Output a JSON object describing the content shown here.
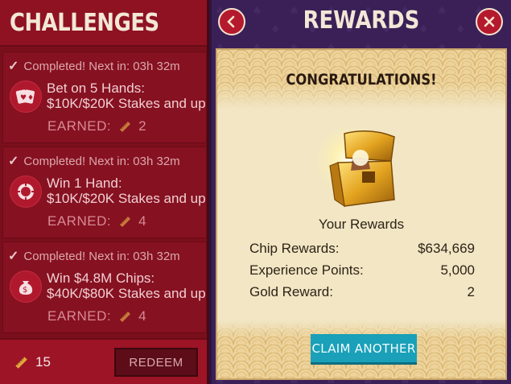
{
  "left_panel": {
    "title": "CHALLENGES",
    "challenges": [
      {
        "status": "Completed!  Next in: 03h 32m",
        "title_line1": "Bet on 5 Hands:",
        "title_line2": "$10K/$20K Stakes and up",
        "earned_label": "EARNED:",
        "earned_value": "2",
        "icon": "playing-cards-icon"
      },
      {
        "status": "Completed!  Next in: 03h 32m",
        "title_line1": "Win 1 Hand:",
        "title_line2": "$10K/$20K Stakes and up",
        "earned_label": "EARNED:",
        "earned_value": "4",
        "icon": "poker-chip-icon"
      },
      {
        "status": "Completed!  Next in: 03h 32m",
        "title_line1": "Win $4.8M Chips:",
        "title_line2": "$40K/$80K Stakes and up",
        "earned_label": "EARNED:",
        "earned_value": "4",
        "icon": "money-bag-icon"
      }
    ],
    "footer": {
      "ticket_count": "15",
      "redeem_label": "REDEEM"
    }
  },
  "right_panel": {
    "title": "REWARDS",
    "back_icon": "chevron-left-icon",
    "close_icon": "close-icon"
  },
  "modal": {
    "heading": "CONGRATULATIONS!",
    "subheading": "Your Rewards",
    "rewards": [
      {
        "label": "Chip Rewards:",
        "value": "$634,669"
      },
      {
        "label": "Experience Points:",
        "value": "5,000"
      },
      {
        "label": "Gold Reward:",
        "value": "2"
      }
    ],
    "button_label": "CLAIM ANOTHER"
  },
  "colors": {
    "challenge_bg": "#861121",
    "panel_purple": "#3b2057",
    "modal_cream": "#f2e6c4",
    "claim_teal": "#1aa0b8",
    "ticket_gold": "#d9a33a"
  }
}
